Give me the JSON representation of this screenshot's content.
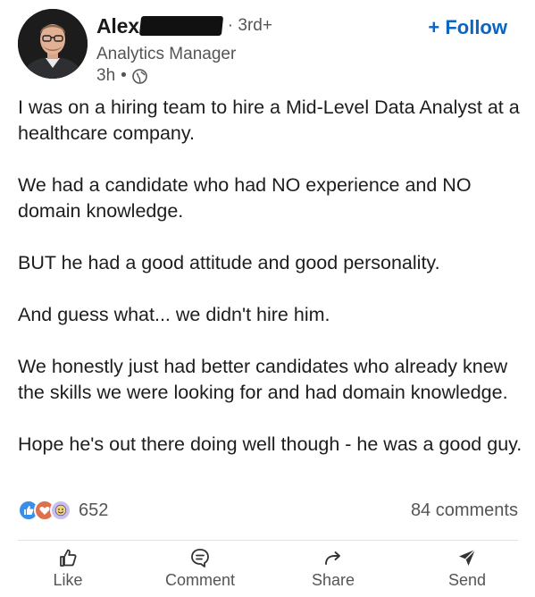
{
  "post": {
    "author": {
      "name": "Alex",
      "degree": "· 3rd+",
      "title": "Analytics Manager",
      "time": "3h",
      "time_separator": "•",
      "visibility_icon": "globe-icon"
    },
    "follow_label": "+ Follow",
    "paragraphs": [
      "I was on a hiring team to hire a Mid-Level Data Analyst at a healthcare company.",
      "We had a candidate who had NO experience and NO domain knowledge.",
      "BUT he had a good attitude and good personality.",
      "And guess what... we didn't hire him.",
      "We honestly just had better candidates who already knew the skills we were looking for and had domain knowledge.",
      "Hope he's out there doing well though - he was a good guy."
    ],
    "reactions": {
      "icons": [
        "like-icon",
        "love-icon",
        "funny-icon"
      ],
      "count": "652"
    },
    "comments_count": "84 comments",
    "actions": {
      "like": "Like",
      "comment": "Comment",
      "share": "Share",
      "send": "Send"
    }
  },
  "colors": {
    "accent": "#0a66c2",
    "text_primary": "#1d1d1d",
    "text_secondary": "#555555",
    "like": "#378fe9",
    "love": "#df704d",
    "funny": "#c8bfee"
  }
}
